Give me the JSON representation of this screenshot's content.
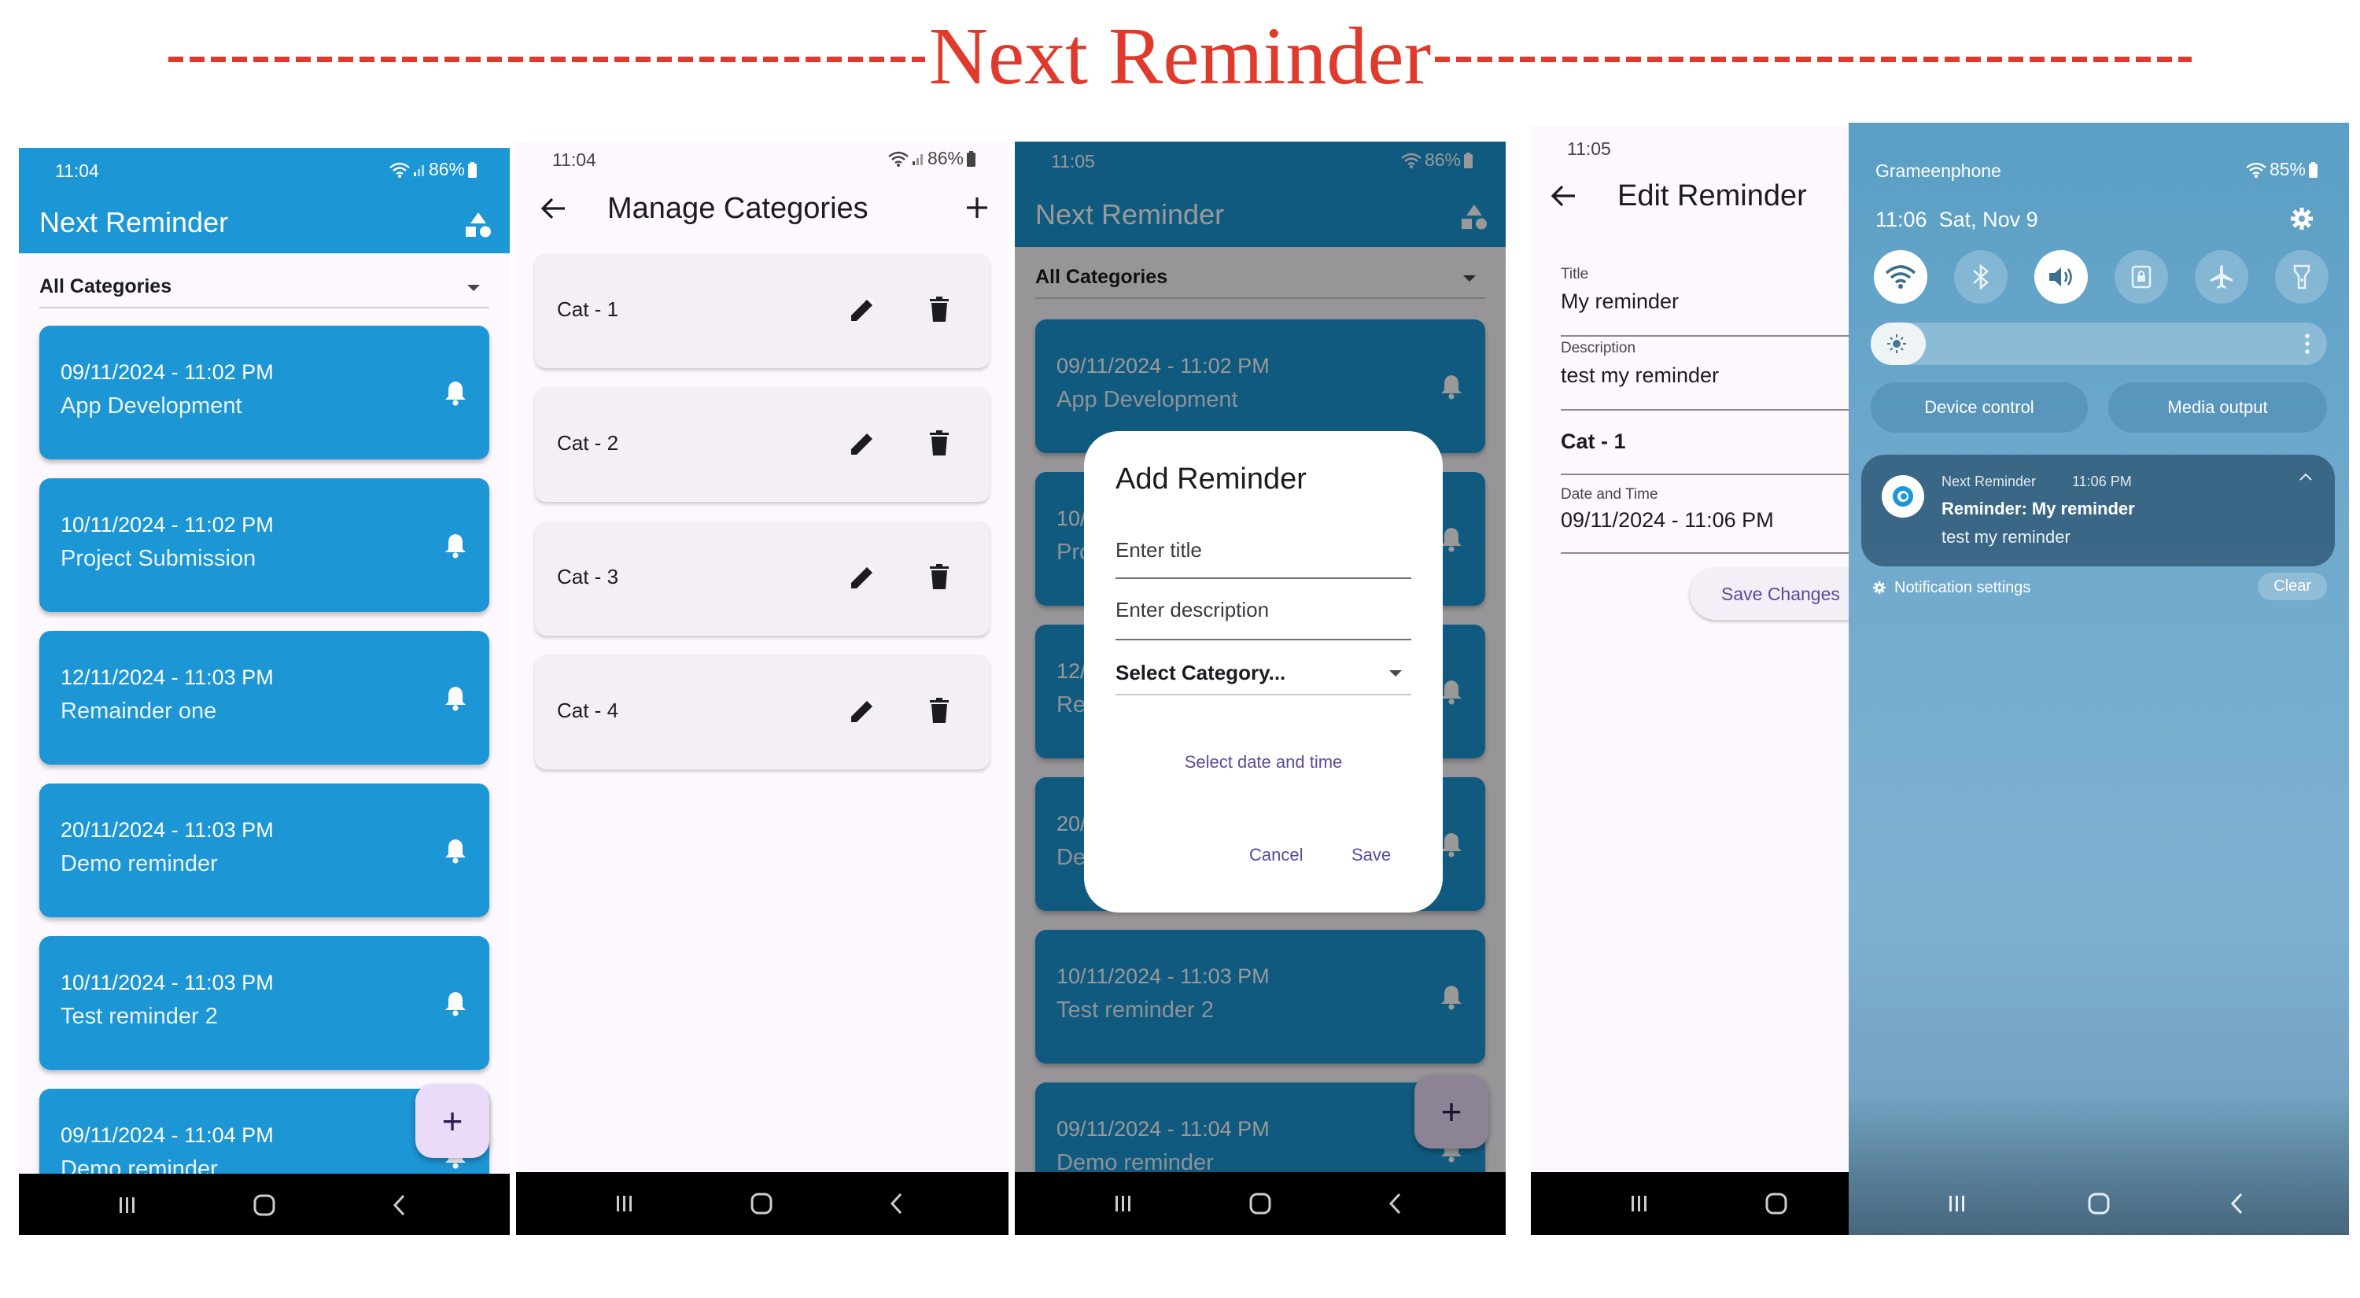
{
  "banner": {
    "title": "Next Reminder"
  },
  "colors": {
    "primary": "#1c96d4",
    "fab": "#eadcf8",
    "dialog_accent": "#5b4a9c",
    "banner": "#e03a2c"
  },
  "screen1": {
    "status_time": "11:04",
    "battery": "86%",
    "app_title": "Next Reminder",
    "app_icon": "shapes-icon",
    "filter": "All Categories",
    "reminders": [
      {
        "date": "09/11/2024 - 11:02 PM",
        "name": "App Development"
      },
      {
        "date": "10/11/2024 - 11:02 PM",
        "name": "Project Submission"
      },
      {
        "date": "12/11/2024 - 11:03 PM",
        "name": "Remainder one"
      },
      {
        "date": "20/11/2024 - 11:03 PM",
        "name": "Demo reminder"
      },
      {
        "date": "10/11/2024 - 11:03 PM",
        "name": "Test reminder 2"
      },
      {
        "date": "09/11/2024 - 11:04 PM",
        "name": "Demo reminder"
      }
    ],
    "fab_label": "+"
  },
  "screen2": {
    "status_time": "11:04",
    "battery": "86%",
    "title": "Manage Categories",
    "categories": [
      {
        "label": "Cat - 1"
      },
      {
        "label": "Cat - 2"
      },
      {
        "label": "Cat - 3"
      },
      {
        "label": "Cat - 4"
      }
    ]
  },
  "screen3": {
    "status_time": "11:05",
    "battery": "86%",
    "app_title": "Next Reminder",
    "filter": "All Categories",
    "background_reminders": [
      {
        "date": "09/11/2024 - 11:02 PM",
        "name": "App Development"
      },
      {
        "date": "10/11/2024 - 11:02 PM",
        "name": "Project Submission"
      },
      {
        "date": "12/11/2024 - 11:03 PM",
        "name": "Remainder one"
      },
      {
        "date": "20/11/2024 - 11:03 PM",
        "name": "Demo reminder"
      },
      {
        "date": "10/11/2024 - 11:03 PM",
        "name": "Test reminder 2"
      },
      {
        "date": "09/11/2024 - 11:04 PM",
        "name": "Demo reminder"
      }
    ],
    "fab_label": "+",
    "dialog": {
      "title": "Add Reminder",
      "title_placeholder": "Enter title",
      "description_placeholder": "Enter description",
      "category_placeholder": "Select Category...",
      "date_button": "Select date and time",
      "cancel": "Cancel",
      "save": "Save"
    }
  },
  "screen4": {
    "status_time": "11:05",
    "title": "Edit Reminder",
    "fields": {
      "title_label": "Title",
      "title_value": "My reminder",
      "description_label": "Description",
      "description_value": "test my reminder",
      "category_value": "Cat - 1",
      "datetime_label": "Date and Time",
      "datetime_value": "09/11/2024 - 11:06 PM"
    },
    "save_button": "Save Changes"
  },
  "screen5": {
    "carrier": "Grameenphone",
    "battery": "85%",
    "datetime": "11:06  Sat, Nov 9",
    "quick_toggles": [
      "wifi-icon",
      "bluetooth-icon",
      "sound-icon",
      "rotation-lock-icon",
      "airplane-mode-icon",
      "flashlight-icon"
    ],
    "device_control": "Device control",
    "media_output": "Media output",
    "notification": {
      "app": "Next Reminder",
      "time": "11:06 PM",
      "title": "Reminder: My reminder",
      "body": "test my reminder"
    },
    "notification_settings": "Notification settings",
    "clear": "Clear"
  }
}
